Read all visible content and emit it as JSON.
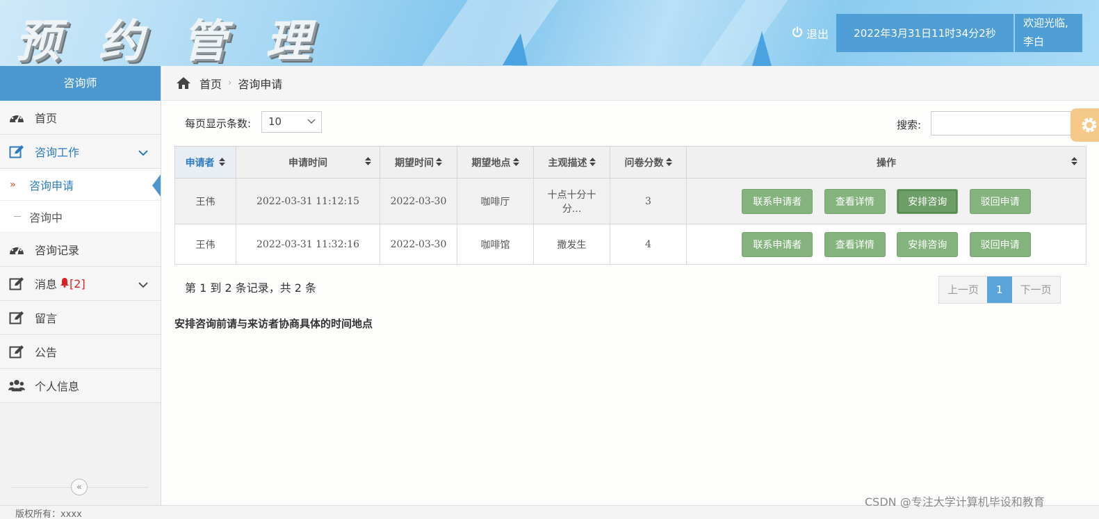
{
  "header": {
    "logo": "预约管理",
    "logout": "退出",
    "datetime": "2022年3月31日11时34分2秒",
    "welcome_line1": "欢迎光临,",
    "welcome_line2": "李白"
  },
  "sidebar": {
    "title": "咨询师",
    "items": [
      {
        "label": "首页",
        "icon": "dashboard-icon"
      },
      {
        "label": "咨询工作",
        "icon": "edit-icon"
      },
      {
        "label": "咨询申请"
      },
      {
        "label": "咨询中"
      },
      {
        "label": "咨询记录",
        "icon": "dashboard-icon"
      },
      {
        "label": "消息",
        "icon": "edit-icon",
        "badge": "[2]"
      },
      {
        "label": "留言",
        "icon": "edit-icon"
      },
      {
        "label": "公告",
        "icon": "edit-icon"
      },
      {
        "label": "个人信息",
        "icon": "users-icon"
      }
    ],
    "collapse": "«"
  },
  "breadcrumb": {
    "home": "首页",
    "current": "咨询申请"
  },
  "toolbar": {
    "page_size_label": "每页显示条数:",
    "page_size_value": "10",
    "search_label": "搜索:"
  },
  "table": {
    "headers": [
      "申请者",
      "申请时间",
      "期望时间",
      "期望地点",
      "主观描述",
      "问卷分数",
      "操作"
    ],
    "rows": [
      {
        "applicant": "王伟",
        "apply_time": "2022-03-31 11:12:15",
        "expect_time": "2022-03-30",
        "place": "咖啡厅",
        "desc1": "十点十分十",
        "desc2": "分...",
        "score": "3"
      },
      {
        "applicant": "王伟",
        "apply_time": "2022-03-31 11:32:16",
        "expect_time": "2022-03-30",
        "place": "咖啡馆",
        "desc1": "撒发生",
        "desc2": "",
        "score": "4"
      }
    ],
    "actions": [
      "联系申请者",
      "查看详情",
      "安排咨询",
      "驳回申请"
    ]
  },
  "pagination": {
    "info": "第 1 到 2 条记录，共 2 条",
    "prev": "上一页",
    "current": "1",
    "next": "下一页"
  },
  "note": "安排咨询前请与来访者协商具体的时间地点",
  "footer": "版权所有：xxxx",
  "watermark": "CSDN @专注大学计算机毕设和教育",
  "colors": {
    "accent": "#4b97cf",
    "button": "#85b37e",
    "active_text": "#2d7cc1"
  }
}
